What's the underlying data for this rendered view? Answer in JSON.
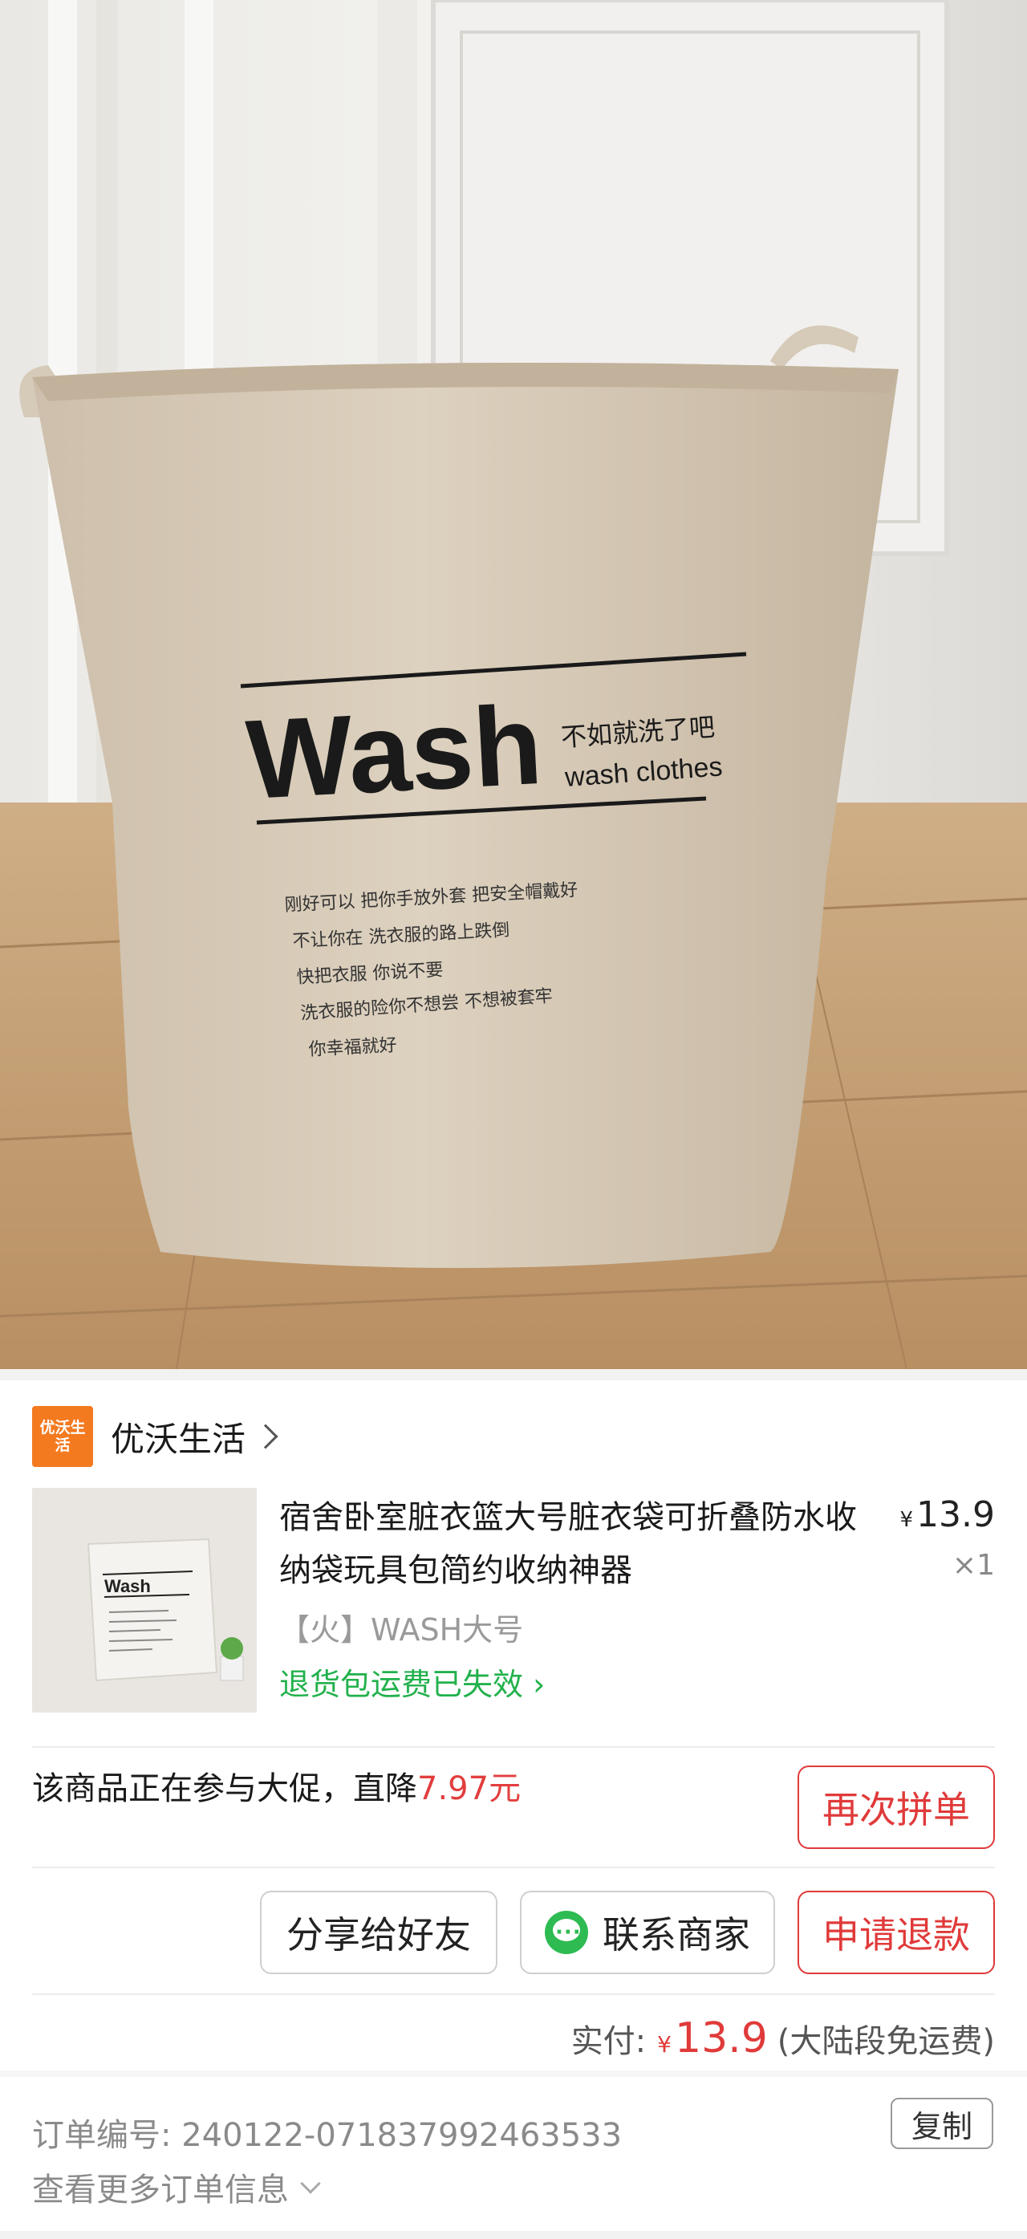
{
  "photo": {
    "bag_brand": "Wash",
    "bag_tagline_cn": "不如就洗了吧",
    "bag_tagline_en": "wash clothes",
    "bag_lines": [
      "刚好可以  把你手放外套  把安全帽戴好",
      "不让你在  洗衣服的路上跌倒",
      "快把衣服  你说不要",
      "洗衣服的险你不想尝  不想被套牢",
      "你幸福就好"
    ]
  },
  "shop": {
    "logo_text": "优沃生活",
    "name": "优沃生活"
  },
  "product": {
    "title": "宿舍卧室脏衣篮大号脏衣袋可折叠防水收纳袋玩具包简约收纳神器",
    "price_symbol": "¥",
    "price": "13.9",
    "quantity": "×1",
    "spec": "【火】WASH大号",
    "refund_notice": "退货包运费已失效",
    "thumb_brand": "Wash"
  },
  "promo": {
    "text": "该商品正在参与大促，直降",
    "amount": "7.97元",
    "rebuy_button": "再次拼单"
  },
  "actions": {
    "share": "分享给好友",
    "contact": "联系商家",
    "refund": "申请退款"
  },
  "payment": {
    "label": "实付:",
    "symbol": "¥",
    "amount": "13.9",
    "note": "(大陆段免运费)"
  },
  "order": {
    "number_label": "订单编号:",
    "number": "240122-071837992463533",
    "copy": "复制",
    "more": "查看更多订单信息"
  },
  "colors": {
    "accent_red": "#e03a3a",
    "green": "#22b14c",
    "shop_logo": "#f47a20"
  }
}
